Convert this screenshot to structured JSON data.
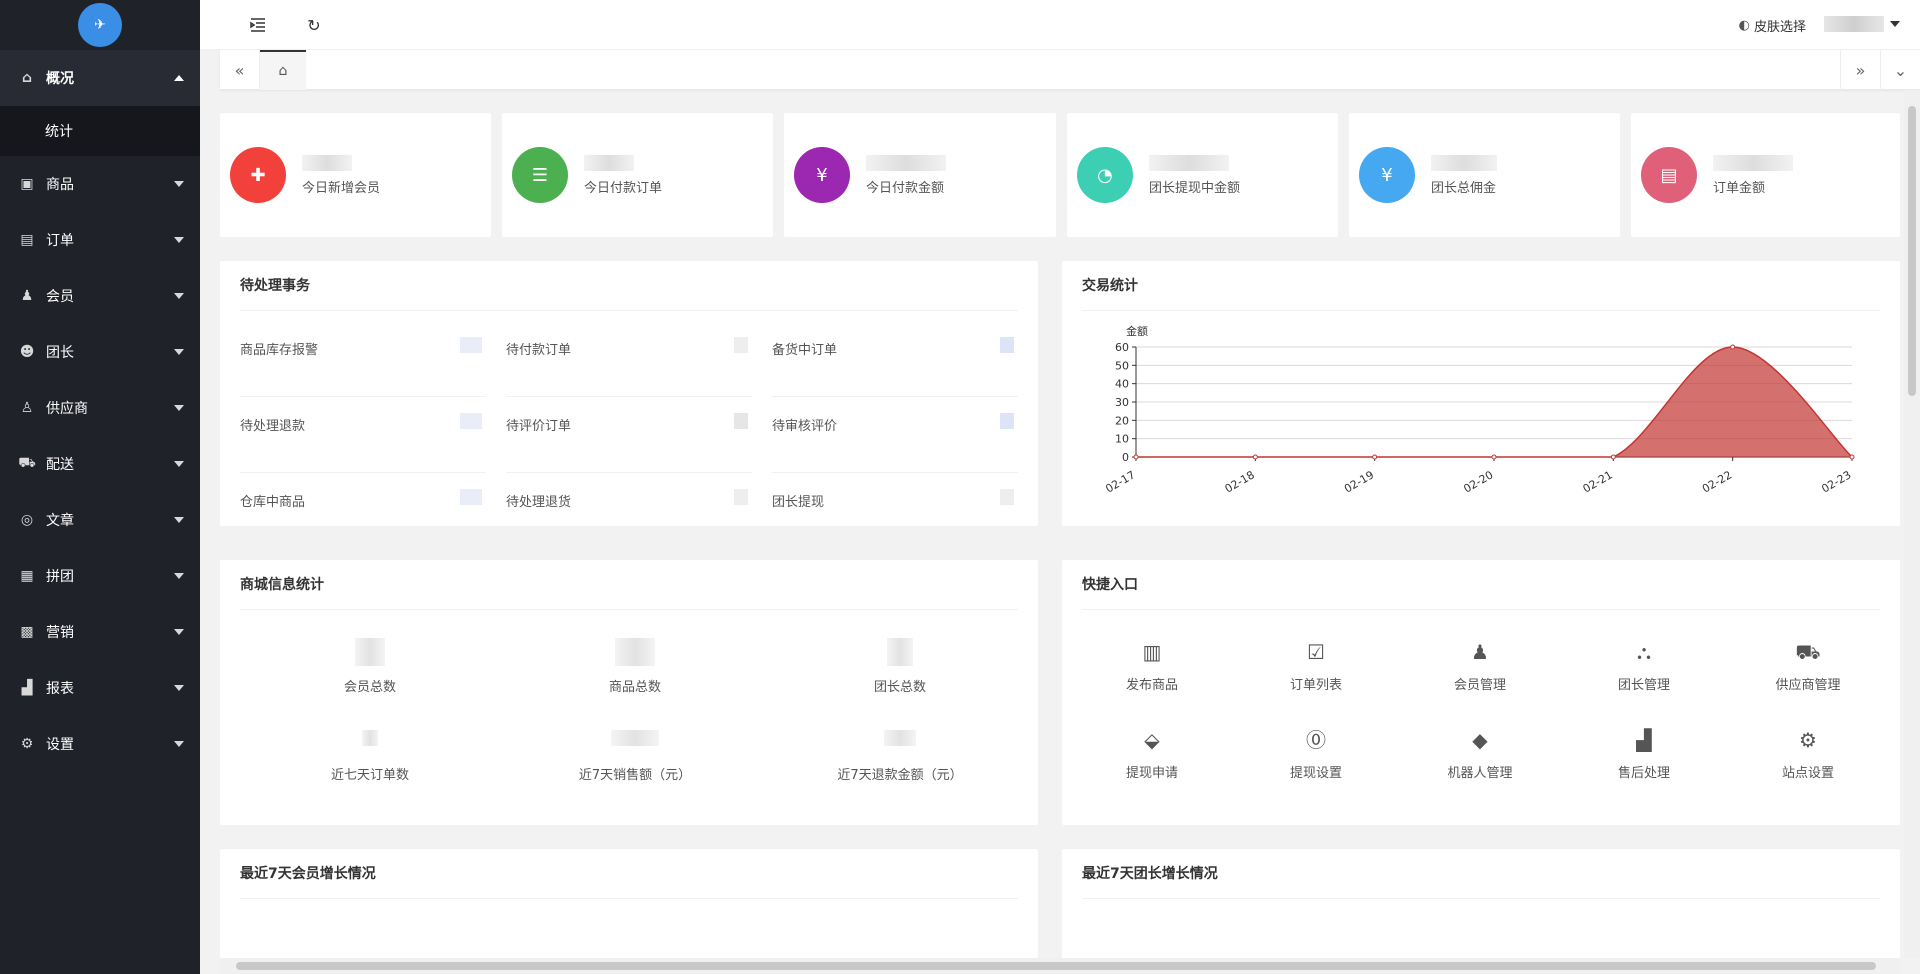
{
  "sidebar": {
    "logo_icon": "app-logo-icon",
    "items": [
      {
        "label": "概况",
        "icon": "home-icon",
        "expanded": true
      },
      {
        "label": "商品",
        "icon": "product-icon"
      },
      {
        "label": "订单",
        "icon": "order-icon"
      },
      {
        "label": "会员",
        "icon": "member-icon"
      },
      {
        "label": "团长",
        "icon": "leader-icon"
      },
      {
        "label": "供应商",
        "icon": "supplier-icon"
      },
      {
        "label": "配送",
        "icon": "truck-icon"
      },
      {
        "label": "文章",
        "icon": "compass-icon"
      },
      {
        "label": "拼团",
        "icon": "group-icon"
      },
      {
        "label": "营销",
        "icon": "gift-icon"
      },
      {
        "label": "报表",
        "icon": "chart-icon"
      },
      {
        "label": "设置",
        "icon": "gear-icon"
      }
    ],
    "sub_item": "统计"
  },
  "header": {
    "skin_label": "皮肤选择"
  },
  "stats": [
    {
      "label": "今日新增会员",
      "color": "#f2413b",
      "icon": "add-user-icon"
    },
    {
      "label": "今日付款订单",
      "color": "#4caf50",
      "icon": "document-icon"
    },
    {
      "label": "今日付款金额",
      "color": "#9c27b0",
      "icon": "yen-icon"
    },
    {
      "label": "团长提现中金额",
      "color": "#3dcfb3",
      "icon": "pie-icon"
    },
    {
      "label": "团长总佣金",
      "color": "#45a8f0",
      "icon": "money-bag-icon"
    },
    {
      "label": "订单金额",
      "color": "#e0607a",
      "icon": "receipt-icon"
    }
  ],
  "pending": {
    "title": "待处理事务",
    "items": [
      "商品库存报警",
      "待付款订单",
      "备货中订单",
      "待处理退款",
      "待评价订单",
      "待审核评价",
      "仓库中商品",
      "待处理退货",
      "团长提现"
    ]
  },
  "trade": {
    "title": "交易统计"
  },
  "chart_data": {
    "type": "area",
    "title": "",
    "ylabel": "金额",
    "xlabel": "",
    "x": [
      "02-17",
      "02-18",
      "02-19",
      "02-20",
      "02-21",
      "02-22",
      "02-23"
    ],
    "series": [
      {
        "values": [
          0,
          0,
          0,
          0,
          0,
          60,
          0
        ]
      }
    ],
    "ylim": [
      0,
      60
    ],
    "yticks": [
      0,
      10,
      20,
      30,
      40,
      50,
      60
    ],
    "color": "#c23531",
    "grid": true
  },
  "mall_info": {
    "title": "商城信息统计",
    "items": [
      "会员总数",
      "商品总数",
      "团长总数",
      "近七天订单数",
      "近7天销售额（元）",
      "近7天退款金额（元）"
    ]
  },
  "quick": {
    "title": "快捷入口",
    "items": [
      {
        "label": "发布商品",
        "icon": "barcode-icon"
      },
      {
        "label": "订单列表",
        "icon": "clipboard-check-icon"
      },
      {
        "label": "会员管理",
        "icon": "user-manage-icon"
      },
      {
        "label": "团长管理",
        "icon": "org-tree-icon"
      },
      {
        "label": "供应商管理",
        "icon": "truck-icon"
      },
      {
        "label": "提现申请",
        "icon": "ticket-icon"
      },
      {
        "label": "提现设置",
        "icon": "yen-circle-icon"
      },
      {
        "label": "机器人管理",
        "icon": "tag-icon"
      },
      {
        "label": "售后处理",
        "icon": "bar-chart-icon"
      },
      {
        "label": "站点设置",
        "icon": "gear-icon"
      }
    ]
  },
  "member_growth": {
    "title": "最近7天会员增长情况"
  },
  "leader_growth": {
    "title": "最近7天团长增长情况"
  }
}
